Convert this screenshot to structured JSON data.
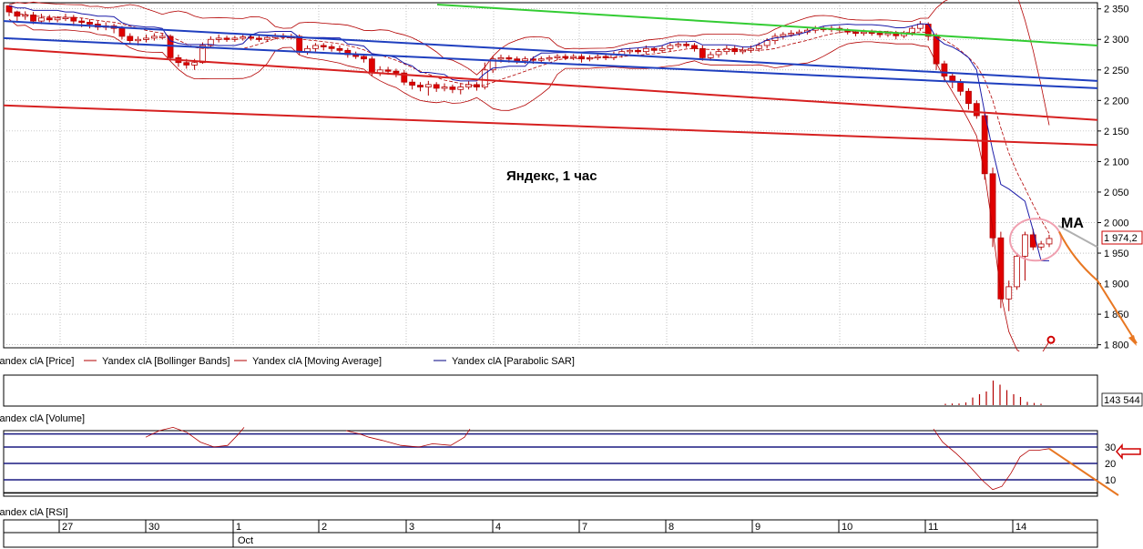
{
  "chart_data": {
    "type": "candlestick",
    "annotation": "Яндекс,  1 час",
    "ma_label": "MA",
    "last_price_label": "1 974,2",
    "y_ticks": [
      "2 350",
      "2 300",
      "2 250",
      "2 200",
      "2 150",
      "2 100",
      "2 050",
      "2 000",
      "1 950",
      "1 900",
      "1 850",
      "1 800"
    ],
    "ylim": [
      1795,
      2360
    ],
    "x_date_labels": [
      "27",
      "30",
      "1",
      "2",
      "3",
      "4",
      "7",
      "8",
      "9",
      "10",
      "11",
      "14"
    ],
    "x_month_label": "Oct",
    "legend": [
      {
        "label": "Yandex clA [Price]",
        "color": "#b30000"
      },
      {
        "label": "Yandex clA [Bollinger Bands]",
        "color": "#b30000"
      },
      {
        "label": "Yandex clA [Moving Average]",
        "color": "#b30000"
      },
      {
        "label": "Yandex clA [Parabolic SAR]",
        "color": "#000080"
      }
    ],
    "volume_label": "Yandex clA [Volume]",
    "volume_last_label": "143 544",
    "volume": [
      0.05,
      0.06,
      0.06,
      0.1,
      0.28,
      0.4,
      0.5,
      0.9,
      0.75,
      0.55,
      0.4,
      0.3,
      0.12,
      0.08,
      0.05
    ],
    "rsi_label": "Yandex clA [RSI]",
    "rsi_ticks": [
      "30",
      "20",
      "10"
    ],
    "candles": [
      [
        2355,
        2345,
        2350,
        2338
      ],
      [
        2345,
        2338,
        2347,
        2330
      ],
      [
        2338,
        2340,
        2346,
        2332
      ],
      [
        2340,
        2330,
        2345,
        2325
      ],
      [
        2330,
        2335,
        2342,
        2325
      ],
      [
        2335,
        2332,
        2340,
        2328
      ],
      [
        2332,
        2335,
        2338,
        2328
      ],
      [
        2335,
        2336,
        2342,
        2330
      ],
      [
        2336,
        2330,
        2340,
        2322
      ],
      [
        2330,
        2328,
        2335,
        2320
      ],
      [
        2328,
        2325,
        2333,
        2318
      ],
      [
        2325,
        2320,
        2330,
        2315
      ],
      [
        2320,
        2322,
        2328,
        2315
      ],
      [
        2322,
        2318,
        2326,
        2310
      ],
      [
        2318,
        2305,
        2322,
        2300
      ],
      [
        2305,
        2298,
        2310,
        2292
      ],
      [
        2298,
        2300,
        2305,
        2290
      ],
      [
        2300,
        2302,
        2308,
        2295
      ],
      [
        2302,
        2305,
        2310,
        2298
      ],
      [
        2305,
        2305,
        2310,
        2300
      ],
      [
        2305,
        2270,
        2308,
        2265
      ],
      [
        2270,
        2262,
        2275,
        2255
      ],
      [
        2262,
        2258,
        2268,
        2252
      ],
      [
        2258,
        2262,
        2268,
        2250
      ],
      [
        2262,
        2290,
        2295,
        2260
      ],
      [
        2290,
        2300,
        2305,
        2285
      ],
      [
        2300,
        2302,
        2308,
        2295
      ],
      [
        2302,
        2300,
        2306,
        2296
      ],
      [
        2300,
        2302,
        2306,
        2296
      ],
      [
        2302,
        2304,
        2308,
        2298
      ],
      [
        2304,
        2302,
        2308,
        2298
      ],
      [
        2302,
        2300,
        2306,
        2296
      ],
      [
        2300,
        2303,
        2307,
        2296
      ],
      [
        2303,
        2306,
        2310,
        2300
      ],
      [
        2306,
        2304,
        2310,
        2300
      ],
      [
        2304,
        2305,
        2309,
        2300
      ],
      [
        2305,
        2280,
        2308,
        2275
      ],
      [
        2280,
        2285,
        2290,
        2275
      ],
      [
        2285,
        2290,
        2294,
        2280
      ],
      [
        2290,
        2288,
        2294,
        2282
      ],
      [
        2288,
        2285,
        2292,
        2280
      ],
      [
        2285,
        2282,
        2290,
        2278
      ],
      [
        2282,
        2275,
        2286,
        2270
      ],
      [
        2275,
        2272,
        2280,
        2268
      ],
      [
        2272,
        2268,
        2276,
        2262
      ],
      [
        2268,
        2245,
        2272,
        2240
      ],
      [
        2245,
        2250,
        2256,
        2240
      ],
      [
        2250,
        2248,
        2255,
        2242
      ],
      [
        2248,
        2245,
        2252,
        2238
      ],
      [
        2245,
        2230,
        2250,
        2225
      ],
      [
        2230,
        2225,
        2235,
        2218
      ],
      [
        2225,
        2222,
        2230,
        2215
      ],
      [
        2222,
        2226,
        2232,
        2208
      ],
      [
        2226,
        2220,
        2230,
        2214
      ],
      [
        2220,
        2222,
        2228,
        2215
      ],
      [
        2222,
        2218,
        2226,
        2212
      ],
      [
        2218,
        2222,
        2228,
        2210
      ],
      [
        2222,
        2226,
        2232,
        2218
      ],
      [
        2226,
        2222,
        2230,
        2216
      ],
      [
        2222,
        2250,
        2262,
        2218
      ],
      [
        2250,
        2268,
        2272,
        2245
      ],
      [
        2268,
        2270,
        2275,
        2262
      ],
      [
        2270,
        2268,
        2274,
        2262
      ],
      [
        2268,
        2265,
        2272,
        2260
      ],
      [
        2265,
        2268,
        2272,
        2260
      ],
      [
        2268,
        2266,
        2272,
        2260
      ],
      [
        2266,
        2268,
        2272,
        2262
      ],
      [
        2268,
        2270,
        2274,
        2264
      ],
      [
        2270,
        2272,
        2276,
        2266
      ],
      [
        2272,
        2270,
        2276,
        2266
      ],
      [
        2270,
        2272,
        2276,
        2266
      ],
      [
        2272,
        2268,
        2276,
        2262
      ],
      [
        2268,
        2270,
        2274,
        2264
      ],
      [
        2270,
        2272,
        2276,
        2266
      ],
      [
        2272,
        2270,
        2276,
        2266
      ],
      [
        2270,
        2275,
        2280,
        2266
      ],
      [
        2275,
        2280,
        2285,
        2270
      ],
      [
        2280,
        2282,
        2286,
        2276
      ],
      [
        2282,
        2280,
        2286,
        2276
      ],
      [
        2280,
        2285,
        2290,
        2276
      ],
      [
        2285,
        2282,
        2288,
        2278
      ],
      [
        2282,
        2285,
        2290,
        2278
      ],
      [
        2285,
        2290,
        2294,
        2280
      ],
      [
        2290,
        2292,
        2296,
        2286
      ],
      [
        2292,
        2290,
        2296,
        2286
      ],
      [
        2290,
        2285,
        2294,
        2280
      ],
      [
        2285,
        2270,
        2290,
        2265
      ],
      [
        2270,
        2275,
        2280,
        2265
      ],
      [
        2275,
        2280,
        2285,
        2270
      ],
      [
        2280,
        2285,
        2290,
        2275
      ],
      [
        2285,
        2280,
        2290,
        2275
      ],
      [
        2280,
        2282,
        2288,
        2276
      ],
      [
        2282,
        2285,
        2290,
        2278
      ],
      [
        2285,
        2290,
        2295,
        2280
      ],
      [
        2290,
        2298,
        2302,
        2285
      ],
      [
        2298,
        2305,
        2310,
        2292
      ],
      [
        2305,
        2308,
        2312,
        2300
      ],
      [
        2308,
        2310,
        2315,
        2304
      ],
      [
        2310,
        2312,
        2316,
        2306
      ],
      [
        2312,
        2315,
        2318,
        2308
      ],
      [
        2315,
        2318,
        2322,
        2310
      ],
      [
        2318,
        2316,
        2322,
        2312
      ],
      [
        2316,
        2318,
        2322,
        2312
      ],
      [
        2318,
        2315,
        2322,
        2310
      ],
      [
        2315,
        2312,
        2318,
        2308
      ],
      [
        2312,
        2310,
        2316,
        2305
      ],
      [
        2310,
        2312,
        2316,
        2306
      ],
      [
        2312,
        2310,
        2316,
        2306
      ],
      [
        2310,
        2308,
        2314,
        2303
      ],
      [
        2308,
        2310,
        2314,
        2304
      ],
      [
        2310,
        2306,
        2314,
        2300
      ],
      [
        2306,
        2310,
        2314,
        2302
      ],
      [
        2310,
        2318,
        2322,
        2306
      ],
      [
        2318,
        2325,
        2330,
        2314
      ],
      [
        2325,
        2305,
        2328,
        2298
      ],
      [
        2305,
        2260,
        2310,
        2250
      ],
      [
        2260,
        2240,
        2265,
        2230
      ],
      [
        2240,
        2230,
        2245,
        2220
      ],
      [
        2230,
        2215,
        2235,
        2208
      ],
      [
        2215,
        2195,
        2220,
        2185
      ],
      [
        2195,
        2175,
        2200,
        2170
      ],
      [
        2175,
        2080,
        2180,
        2070
      ],
      [
        2080,
        1975,
        2090,
        1960
      ],
      [
        1975,
        1875,
        1985,
        1860
      ],
      [
        1875,
        1895,
        1905,
        1855
      ],
      [
        1895,
        1945,
        1950,
        1890
      ],
      [
        1945,
        1980,
        1985,
        1905
      ],
      [
        1980,
        1960,
        1990,
        1955
      ],
      [
        1960,
        1965,
        1970,
        1955
      ],
      [
        1965,
        1974,
        1980,
        1960
      ]
    ]
  }
}
